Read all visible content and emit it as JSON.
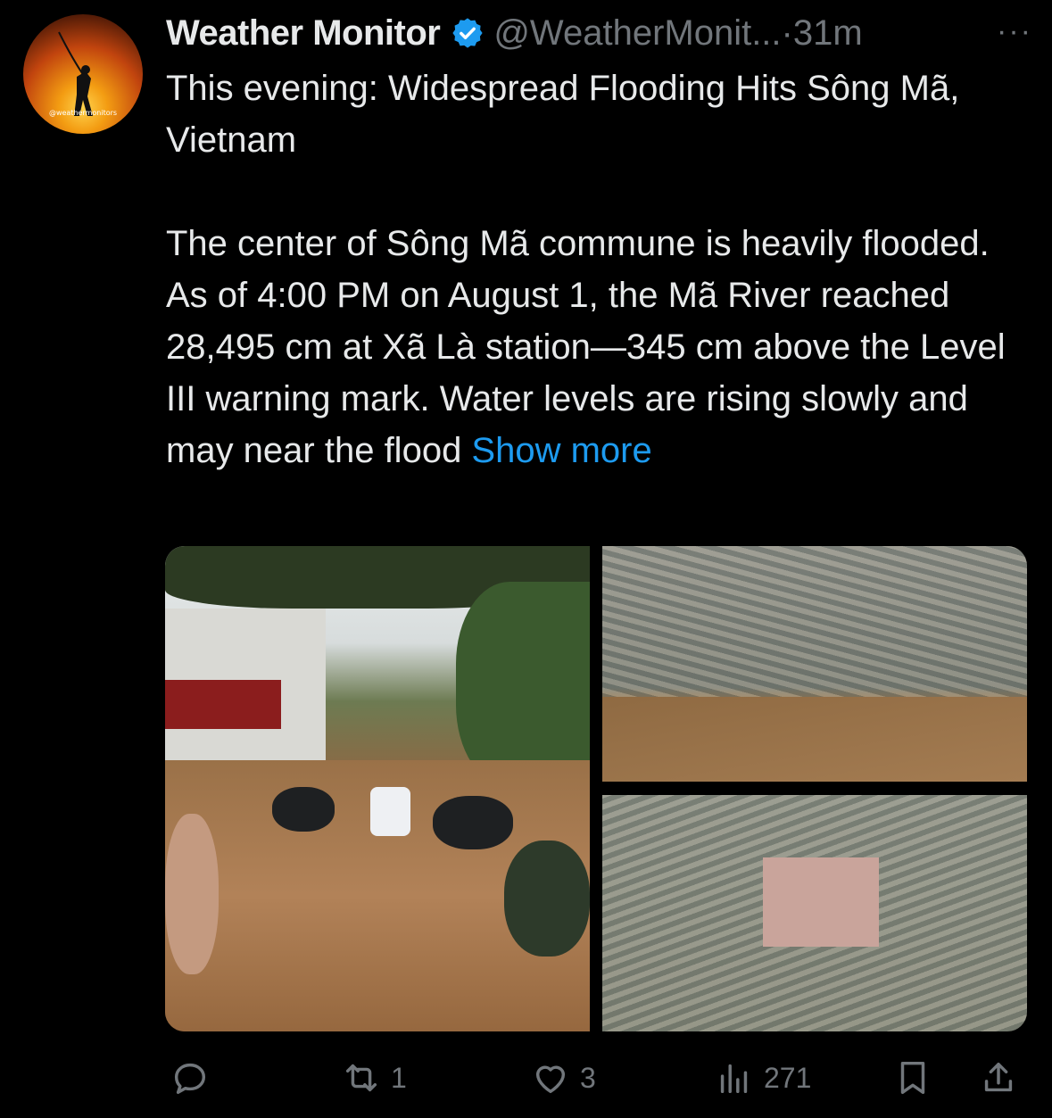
{
  "account": {
    "display_name": "Weather Monitor",
    "handle": "@WeatherMonit...",
    "time": "·31m",
    "avatar_text": "@weathermonitors",
    "more_label": "···"
  },
  "tweet": {
    "headline": "This evening: Widespread Flooding Hits Sông Mã, Vietnam",
    "body": "The center of Sông Mã commune is heavily flooded. As of 4:00 PM on August 1, the Mã River reached 28,495 cm at Xã Là station—345 cm above the Level III warning mark. Water levels are rising slowly and may near the flood ",
    "show_more": "Show more"
  },
  "media": {
    "images": [
      "flooded-street-people-wading",
      "aerial-flooded-town-river",
      "aerial-flooded-town-plaza"
    ]
  },
  "actions": {
    "reply_count": "",
    "retweet_count": "1",
    "like_count": "3",
    "views_count": "271"
  },
  "colors": {
    "background": "#000000",
    "text": "#e7e9ea",
    "muted": "#71767b",
    "link": "#1d9bf0",
    "verified": "#1d9bf0"
  }
}
